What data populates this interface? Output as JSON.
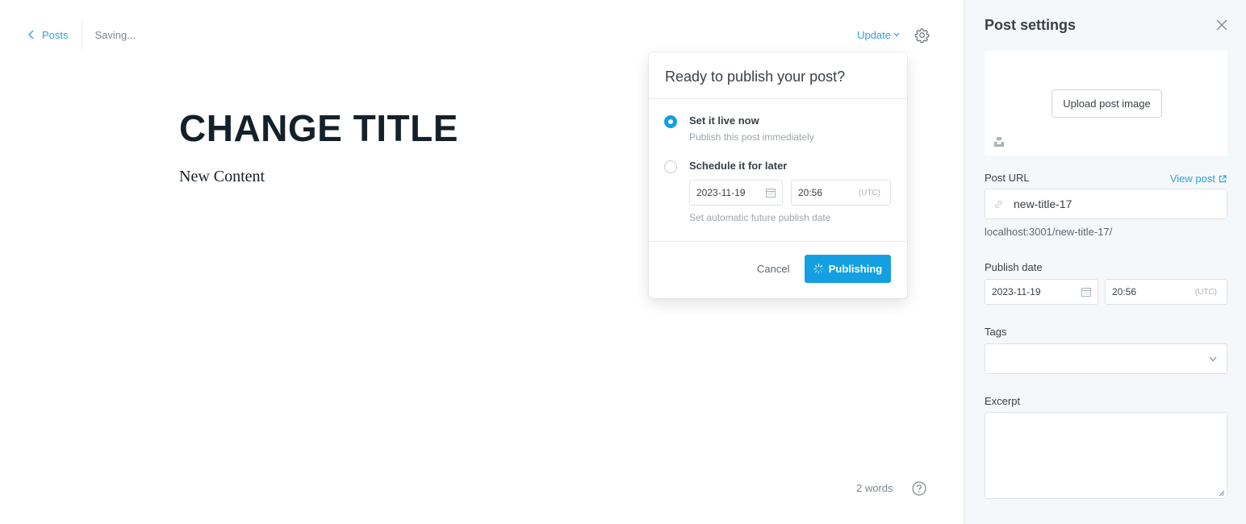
{
  "editor": {
    "back_label": "Posts",
    "status": "Saving...",
    "update_label": "Update",
    "title": "CHANGE TITLE",
    "content": "New Content",
    "word_count": "2 words"
  },
  "publish_popup": {
    "heading": "Ready to publish your post?",
    "option_now": {
      "title": "Set it live now",
      "subtitle": "Publish this post immediately",
      "selected": true
    },
    "option_later": {
      "title": "Schedule it for later",
      "selected": false
    },
    "date": "2023-11-19",
    "time": "20:56",
    "tz": "(UTC)",
    "hint": "Set automatic future publish date",
    "cancel_label": "Cancel",
    "publish_label": "Publishing"
  },
  "sidebar": {
    "title": "Post settings",
    "upload_label": "Upload post image",
    "url_label": "Post URL",
    "view_post_label": "View post",
    "slug": "new-title-17",
    "full_url": "localhost:3001/new-title-17/",
    "publish_date_label": "Publish date",
    "date": "2023-11-19",
    "time": "20:56",
    "tz": "(UTC)",
    "tags_label": "Tags",
    "excerpt_label": "Excerpt",
    "excerpt_value": ""
  },
  "colors": {
    "accent": "#14a0e0",
    "link": "#30a2d6",
    "sidebar_bg": "#f4f8fb"
  }
}
